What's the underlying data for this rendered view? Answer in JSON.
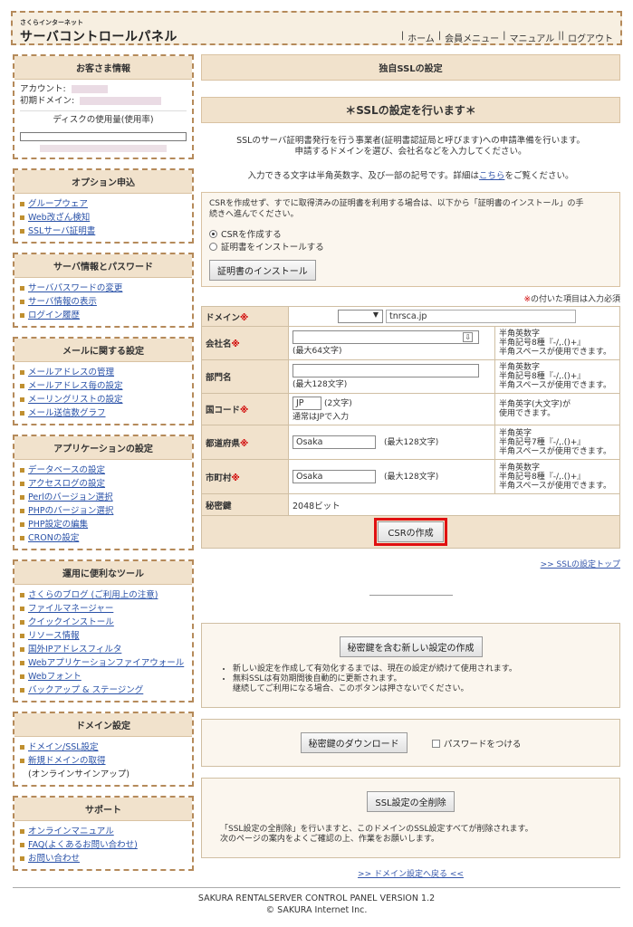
{
  "header": {
    "logo_small": "さくらインターネット",
    "logo_big": "サーバコントロールパネル",
    "nav": [
      "ホーム",
      "会員メニュー",
      "マニュアル",
      "ログアウト"
    ]
  },
  "sidebar": {
    "customer": {
      "title": "お客さま情報",
      "account_label": "アカウント:",
      "domain_label": "初期ドメイン:",
      "disk_label": "ディスクの使用量(使用率)"
    },
    "sections": [
      {
        "title": "オプション申込",
        "items": [
          "グループウェア",
          "Web改ざん検知",
          "SSLサーバ証明書"
        ]
      },
      {
        "title": "サーバ情報とパスワード",
        "items": [
          "サーバパスワードの変更",
          "サーバ情報の表示",
          "ログイン履歴"
        ]
      },
      {
        "title": "メールに関する設定",
        "items": [
          "メールアドレスの管理",
          "メールアドレス毎の設定",
          "メーリングリストの設定",
          "メール送信数グラフ"
        ]
      },
      {
        "title": "アプリケーションの設定",
        "items": [
          "データベースの設定",
          "アクセスログの設定",
          "Perlのバージョン選択",
          "PHPのバージョン選択",
          "PHP設定の編集",
          "CRONの設定"
        ]
      },
      {
        "title": "運用に便利なツール",
        "items": [
          "さくらのブログ (ご利用上の注意)",
          "ファイルマネージャー",
          "クイックインストール",
          "リソース情報",
          "国外IPアドレスフィルタ",
          "Webアプリケーションファイアウォール",
          "Webフォント",
          "バックアップ & ステージング"
        ]
      },
      {
        "title": "ドメイン設定",
        "items": [
          "ドメイン/SSL設定",
          "新規ドメインの取得",
          "(オンラインサインアップ)"
        ]
      },
      {
        "title": "サポート",
        "items": [
          "オンラインマニュアル",
          "FAQ(よくあるお問い合わせ)",
          "お問い合わせ"
        ]
      }
    ]
  },
  "main": {
    "panel_title": "独自SSLの設定",
    "section_head": "＊SSLの設定を行います＊",
    "intro_line1": "SSLのサーバ証明書発行を行う事業者(証明書認証局と呼びます)への申請準備を行います。",
    "intro_line2": "申請するドメインを選び、会社名などを入力してください。",
    "intro_line3_pre": "入力できる文字は半角英数字、及び一部の記号です。詳細は",
    "intro_line3_link": "こちら",
    "intro_line3_post": "をご覧ください。",
    "notice_line1": "CSRを作成せず、すでに取得済みの証明書を利用する場合は、以下から「証明書のインストール」の手",
    "notice_line2": "続きへ進んでください。",
    "radio_create": "CSRを作成する",
    "radio_install": "証明書をインストールする",
    "install_button": "証明書のインストール",
    "req_note_mark": "※",
    "req_note_text": "の付いた項目は入力必須",
    "req_mark": "※",
    "form": {
      "domain_label": "ドメイン",
      "domain_value": "tnrsca.jp",
      "company_label": "会社名",
      "company_max": "(最大64文字)",
      "company_hint": [
        "半角英数字",
        "半角記号8種『-/,.()+』",
        "半角スペースが使用できます。"
      ],
      "dept_label": "部門名",
      "dept_max": "(最大128文字)",
      "dept_hint": [
        "半角英数字",
        "半角記号8種『-/,.()+』",
        "半角スペースが使用できます。"
      ],
      "country_label": "国コード",
      "country_value": "JP",
      "country_len": "(2文字)",
      "country_note": "通常はJPで入力",
      "country_hint": [
        "半角英字(大文字)が",
        "使用できます。"
      ],
      "pref_label": "都道府県",
      "pref_value": "Osaka",
      "pref_max": "(最大128文字)",
      "pref_hint": [
        "半角英字",
        "半角記号7種『-/,.()+』",
        "半角スペースが使用できます。"
      ],
      "city_label": "市町村",
      "city_value": "Osaka",
      "city_max": "(最大128文字)",
      "city_hint": [
        "半角英数字",
        "半角記号8種『-/,.()+』",
        "半角スペースが使用できます。"
      ],
      "key_label": "秘密鍵",
      "key_value": "2048ビット",
      "csr_button": "CSRの作成"
    },
    "ssl_top_link": ">> SSLの設定トップ",
    "newkey_button": "秘密鍵を含む新しい設定の作成",
    "newkey_notes": [
      "新しい設定を作成して有効化するまでは、現在の設定が続けて使用されます。",
      "無料SSLは有効期間後自動的に更新されます。",
      "継続してご利用になる場合、このボタンは押さないでください。"
    ],
    "download_button": "秘密鍵のダウンロード",
    "password_check": "パスワードをつける",
    "delete_button": "SSL設定の全削除",
    "delete_note1": "「SSL設定の全削除」を行いますと、このドメインのSSL設定すべてが削除されます。",
    "delete_note2": "次のページの案内をよくご確認の上、作業をお願いします。",
    "back_link": ">> ドメイン設定へ戻る <<"
  },
  "footer": {
    "line1": "SAKURA RENTALSERVER CONTROL PANEL VERSION 1.2",
    "line2": "© SAKURA Internet Inc."
  },
  "colors": {
    "accent_border": "#b58a5a",
    "header_bg": "#f1e2cc",
    "link": "#2a52a8",
    "required": "#d00000",
    "highlight": "#e01010"
  }
}
